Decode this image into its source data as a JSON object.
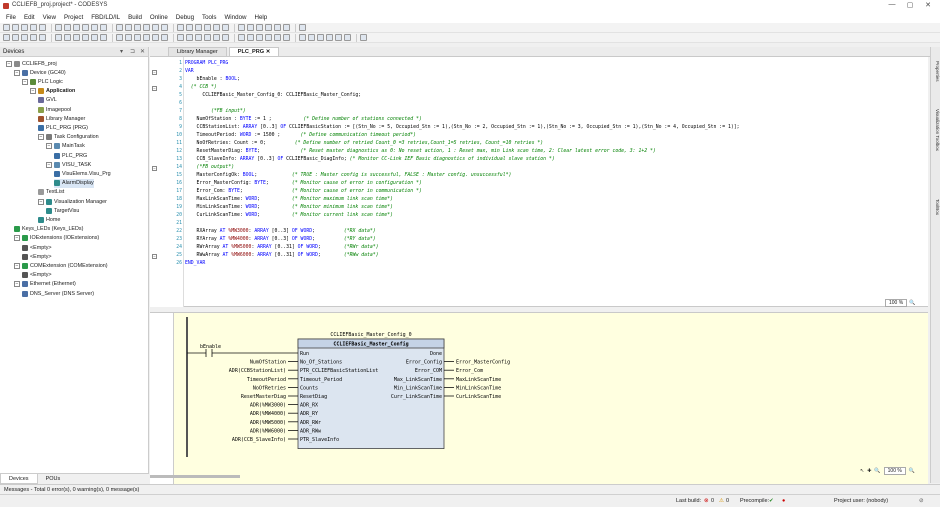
{
  "window": {
    "title": "CCLIEFB_proj.project* - CODESYS",
    "min": "—",
    "max": "▢",
    "close": "✕"
  },
  "menu": [
    "File",
    "Edit",
    "View",
    "Project",
    "FBD/LD/IL",
    "Build",
    "Online",
    "Debug",
    "Tools",
    "Window",
    "Help"
  ],
  "devices": {
    "title": "Devices",
    "tabs": [
      "Devices",
      "POUs"
    ],
    "tree": [
      {
        "label": "CCLIEFB_proj",
        "lvl": 0,
        "exp": "−",
        "icon": "project-icon"
      },
      {
        "label": "Device (GC40)",
        "lvl": 1,
        "exp": "−",
        "icon": "device-icon"
      },
      {
        "label": "PLC Logic",
        "lvl": 2,
        "exp": "−",
        "icon": "plc-logic-icon"
      },
      {
        "label": "Application",
        "lvl": 3,
        "exp": "−",
        "icon": "application-icon",
        "bold": true
      },
      {
        "label": "GVL",
        "lvl": 4,
        "icon": "gvl-icon"
      },
      {
        "label": "Imagepool",
        "lvl": 4,
        "icon": "imagepool-icon"
      },
      {
        "label": "Library Manager",
        "lvl": 4,
        "icon": "library-icon"
      },
      {
        "label": "PLC_PRG (PRG)",
        "lvl": 4,
        "icon": "pou-icon"
      },
      {
        "label": "Task Configuration",
        "lvl": 4,
        "exp": "−",
        "icon": "task-config-icon"
      },
      {
        "label": "MainTask",
        "lvl": 5,
        "exp": "−",
        "icon": "task-icon"
      },
      {
        "label": "PLC_PRG",
        "lvl": 6,
        "icon": "pou-call-icon"
      },
      {
        "label": "VISU_TASK",
        "lvl": 5,
        "exp": "−",
        "icon": "task-icon"
      },
      {
        "label": "VisuElems.Visu_Prg",
        "lvl": 6,
        "icon": "pou-call-icon"
      },
      {
        "label": "AlarmDisplay",
        "lvl": 6,
        "icon": "visu-icon",
        "sel": true
      },
      {
        "label": "TextList",
        "lvl": 4,
        "icon": "textlist-icon"
      },
      {
        "label": "Visualization Manager",
        "lvl": 4,
        "exp": "−",
        "icon": "visu-manager-icon"
      },
      {
        "label": "TargetVisu",
        "lvl": 5,
        "icon": "target-visu-icon"
      },
      {
        "label": "Home",
        "lvl": 4,
        "icon": "visu-icon"
      },
      {
        "label": "Keys_LEDs (Keys_LEDs)",
        "lvl": 1,
        "icon": "io-icon"
      },
      {
        "label": "IOExtensions (IOExtensions)",
        "lvl": 1,
        "exp": "−",
        "icon": "io-icon"
      },
      {
        "label": "<Empty>",
        "lvl": 2,
        "icon": "slot-icon"
      },
      {
        "label": "<Empty>",
        "lvl": 2,
        "icon": "slot-icon"
      },
      {
        "label": "COMExtension (COMExtension)",
        "lvl": 1,
        "exp": "−",
        "icon": "io-icon"
      },
      {
        "label": "<Empty>",
        "lvl": 2,
        "icon": "slot-icon"
      },
      {
        "label": "Ethernet (Ethernet)",
        "lvl": 1,
        "exp": "−",
        "icon": "ethernet-icon"
      },
      {
        "label": "DNS_Server (DNS Server)",
        "lvl": 2,
        "icon": "dns-icon"
      }
    ]
  },
  "editor": {
    "tabs": [
      "Library Manager",
      "PLC_PRG"
    ],
    "active_tab": 1,
    "lines": [
      [
        [
          "kw",
          "PROGRAM PLC_PRG"
        ]
      ],
      [
        [
          "kw",
          "VAR"
        ]
      ],
      [
        [
          "tx",
          "    bEnable : "
        ],
        [
          "kw",
          "BOOL"
        ],
        [
          "tx",
          ";"
        ]
      ],
      [
        [
          "cm",
          "  (* CCB *)"
        ]
      ],
      [
        [
          "tx",
          "      CCLIEFBasic_Master_Config_0: CCLIEFBasic_Master_Config;"
        ]
      ],
      [],
      [
        [
          "cm",
          "         (*FB input*)"
        ]
      ],
      [
        [
          "tx",
          "    NumOfStation : "
        ],
        [
          "kw",
          "BYTE"
        ],
        [
          "tx",
          " := 1 ;           "
        ],
        [
          "cm",
          "(* Define number of stations connected *)"
        ]
      ],
      [
        [
          "tx",
          "    CCBStationList: "
        ],
        [
          "kw",
          "ARRAY"
        ],
        [
          "tx",
          " [0..3] "
        ],
        [
          "kw",
          "OF"
        ],
        [
          "tx",
          " CCLIEFBasicStation := [(Stn_No := 5, Occupied_Stn := 1),(Stn_No := 2, Occupied_Stn := 1),(Stn_No := 3, Occupied_Stn := 1),(Stn_No := 4, Occupied_Stn := 1)];"
        ]
      ],
      [
        [
          "tx",
          "    TimeoutPeriod: "
        ],
        [
          "kw",
          "WORD"
        ],
        [
          "tx",
          " := 1500 ;       "
        ],
        [
          "cm",
          "(* Define communication timeout period*)"
        ]
      ],
      [
        [
          "tx",
          "    NoOfRetries: Count := 0;          "
        ],
        [
          "cm",
          "(* Define number of retried Count_0 =3 retries,Count_1=5 retries, Count_=10 retries *)"
        ]
      ],
      [
        [
          "tx",
          "    ResetMasterDiag: "
        ],
        [
          "kw",
          "BYTE"
        ],
        [
          "tx",
          ";              "
        ],
        [
          "cm",
          "(* Reset master diagnostics as 0: No reset action, 1 : Reset max, min Link scan time, 2: Clear latest error code, 3: 1+2 *)"
        ]
      ],
      [
        [
          "tx",
          "    CCB_SlaveInfo: "
        ],
        [
          "kw",
          "ARRAY"
        ],
        [
          "tx",
          " [0..3] "
        ],
        [
          "kw",
          "OF"
        ],
        [
          "tx",
          " CCLIEFBasic_DiagInfo; "
        ],
        [
          "cm",
          "(* Monitor CC-Link IEF Basic diagnostics of individual slave station *)"
        ]
      ],
      [
        [
          "cm",
          "    (*FB output*)"
        ]
      ],
      [
        [
          "tx",
          "    MasterConfigOk: "
        ],
        [
          "kw",
          "BOOL"
        ],
        [
          "tx",
          ";            "
        ],
        [
          "cm",
          "(* TRUE : Master config is successful, FALSE : Master config. unsuccessful*)"
        ]
      ],
      [
        [
          "tx",
          "    Error_MasterConfig: "
        ],
        [
          "kw",
          "BYTE"
        ],
        [
          "tx",
          ";        "
        ],
        [
          "cm",
          "(* Monitor cause of error in configuration *)"
        ]
      ],
      [
        [
          "tx",
          "    Error_Com: "
        ],
        [
          "kw",
          "BYTE"
        ],
        [
          "tx",
          ";                 "
        ],
        [
          "cm",
          "(* Monitor cause of error in communication *)"
        ]
      ],
      [
        [
          "tx",
          "    MaxLinkScanTime: "
        ],
        [
          "kw",
          "WORD"
        ],
        [
          "tx",
          ";           "
        ],
        [
          "cm",
          "(* Monitor maximum link scan time*)"
        ]
      ],
      [
        [
          "tx",
          "    MinLinkScanTime: "
        ],
        [
          "kw",
          "WORD"
        ],
        [
          "tx",
          ";           "
        ],
        [
          "cm",
          "(* Monitor minimum link scan time*)"
        ]
      ],
      [
        [
          "tx",
          "    CurLinkScanTime: "
        ],
        [
          "kw",
          "WORD"
        ],
        [
          "tx",
          ";           "
        ],
        [
          "cm",
          "(* Monitor current link scan time*)"
        ]
      ],
      [],
      [
        [
          "tx",
          "    RXArray "
        ],
        [
          "kw",
          "AT"
        ],
        [
          "ad",
          " %MW3000"
        ],
        [
          "tx",
          ": "
        ],
        [
          "kw",
          "ARRAY"
        ],
        [
          "tx",
          " [0..3] "
        ],
        [
          "kw",
          "OF WORD"
        ],
        [
          "tx",
          ";          "
        ],
        [
          "cm",
          "(*RX data*)"
        ]
      ],
      [
        [
          "tx",
          "    RYArray "
        ],
        [
          "kw",
          "AT"
        ],
        [
          "ad",
          " %MW4000"
        ],
        [
          "tx",
          ": "
        ],
        [
          "kw",
          "ARRAY"
        ],
        [
          "tx",
          " [0..3] "
        ],
        [
          "kw",
          "OF WORD"
        ],
        [
          "tx",
          ";          "
        ],
        [
          "cm",
          "(*RY data*)"
        ]
      ],
      [
        [
          "tx",
          "    RWrArray "
        ],
        [
          "kw",
          "AT"
        ],
        [
          "ad",
          " %MW5000"
        ],
        [
          "tx",
          ": "
        ],
        [
          "kw",
          "ARRAY"
        ],
        [
          "tx",
          " [0..31] "
        ],
        [
          "kw",
          "OF WORD"
        ],
        [
          "tx",
          ";        "
        ],
        [
          "cm",
          "(*RWr data*)"
        ]
      ],
      [
        [
          "tx",
          "    RWwArray "
        ],
        [
          "kw",
          "AT"
        ],
        [
          "ad",
          " %MW6000"
        ],
        [
          "tx",
          ": "
        ],
        [
          "kw",
          "ARRAY"
        ],
        [
          "tx",
          " [0..31] "
        ],
        [
          "kw",
          "OF WORD"
        ],
        [
          "tx",
          ";        "
        ],
        [
          "cm",
          "(*RWw data*)"
        ]
      ],
      [
        [
          "kw",
          "END_VAR"
        ]
      ]
    ],
    "zoom_top": "100 %"
  },
  "fbd": {
    "enable": "bEnable",
    "instance": "CCLIEFBasic_Master_Config_0",
    "block": "CCLIEFBasic_Master_Config",
    "inputs": [
      {
        "pin": "Run",
        "var": ""
      },
      {
        "pin": "No_Of_Stations",
        "var": "NumOfStation"
      },
      {
        "pin": "PTR_CCLIEFBasicStationList",
        "var": "ADR(CCBStationList)"
      },
      {
        "pin": "Timeout_Period",
        "var": "TimeoutPeriod"
      },
      {
        "pin": "Counts",
        "var": "NoOfRetries"
      },
      {
        "pin": "ResetDiag",
        "var": "ResetMasterDiag"
      },
      {
        "pin": "ADR_RX",
        "var": "ADR(%MW3000)"
      },
      {
        "pin": "ADR_RY",
        "var": "ADR(%MW4000)"
      },
      {
        "pin": "ADR_RWr",
        "var": "ADR(%MW5000)"
      },
      {
        "pin": "ADR_RWw",
        "var": "ADR(%MW6000)"
      },
      {
        "pin": "PTR_SlaveInfo",
        "var": "ADR(CCB_SlaveInfo)"
      }
    ],
    "outputs": [
      {
        "pin": "Done",
        "var": ""
      },
      {
        "pin": "Error_Config",
        "var": "Error_MasterConfig"
      },
      {
        "pin": "Error_COM",
        "var": "Error_Com"
      },
      {
        "pin": "Max_LinkScanTime",
        "var": "MaxLinkScanTime"
      },
      {
        "pin": "Min_LinkScanTime",
        "var": "MinLinkScanTime"
      },
      {
        "pin": "Curr_LinkScanTime",
        "var": "CurLinkScanTime"
      }
    ],
    "zoom": "100 %"
  },
  "right_tabs": [
    "Properties",
    "Visualization Toolbox",
    "ToolBox"
  ],
  "messages": "Messages - Total 0 error(s), 0 warning(s), 0 message(s)",
  "status": {
    "last_build": "Last build:",
    "errors": "0",
    "warnings": "0",
    "precompile": "Precompile:",
    "project_user": "Project user: (nobody)"
  }
}
